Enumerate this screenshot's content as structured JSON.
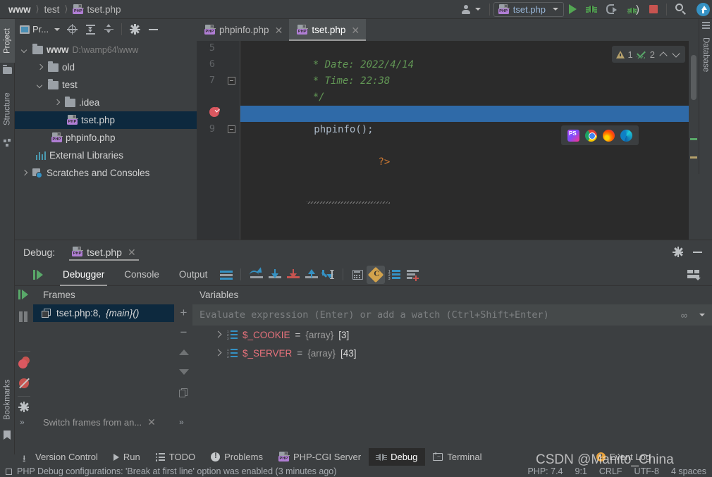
{
  "breadcrumb": {
    "items": [
      "www",
      "test",
      "tset.php"
    ]
  },
  "toolbar": {
    "user_icon": "user-account-icon",
    "run_config": {
      "label": "tset.php",
      "icon": "php-file-icon"
    },
    "run_label": "Run",
    "debug_label": "Debug",
    "attach_label": "Attach to Process",
    "listen_label": "Listen for PHP Debug Connections",
    "stop_label": "Stop",
    "search_label": "Search Everywhere",
    "update_label": "Update"
  },
  "left_strip": {
    "tabs": [
      "Project",
      "Structure",
      "Bookmarks"
    ]
  },
  "right_strip": {
    "tabs": [
      "Database"
    ]
  },
  "project": {
    "title": "Pr...",
    "toolbar_icons": [
      "locate-icon",
      "expand-all-icon",
      "collapse-all-icon",
      "settings-icon",
      "hide-icon"
    ],
    "tree": [
      {
        "label": "www",
        "path": "D:\\wamp64\\www",
        "type": "folder",
        "state": "expanded",
        "indent": 0,
        "bold": true
      },
      {
        "label": "old",
        "type": "folder",
        "state": "collapsed",
        "indent": 1
      },
      {
        "label": "test",
        "type": "folder",
        "state": "expanded",
        "indent": 1
      },
      {
        "label": ".idea",
        "type": "folder",
        "state": "collapsed",
        "indent": 2
      },
      {
        "label": "tset.php",
        "type": "php",
        "state": "none",
        "indent": 3,
        "selected": true
      },
      {
        "label": "phpinfo.php",
        "type": "php",
        "state": "none",
        "indent": 2
      },
      {
        "label": "External Libraries",
        "type": "library",
        "state": "none",
        "indent": 1
      },
      {
        "label": "Scratches and Consoles",
        "type": "scratch",
        "state": "collapsed",
        "indent": 0
      }
    ]
  },
  "editor": {
    "tabs": [
      {
        "label": "phpinfo.php",
        "active": false
      },
      {
        "label": "tset.php",
        "active": true
      }
    ],
    "lines": [
      {
        "num": "5",
        "text": " * Date: 2022/4/14",
        "kind": "comment"
      },
      {
        "num": "6",
        "text": " * Time: 22:38",
        "kind": "comment"
      },
      {
        "num": "7",
        "text": " */",
        "kind": "comment",
        "fold": true
      },
      {
        "num": "8",
        "text": "phpinfo();",
        "kind": "code",
        "highlighted": true,
        "breakpoint": true
      },
      {
        "num": "9",
        "text": "?>",
        "kind": "closetag",
        "fold": true,
        "warning": true
      }
    ],
    "inspection": {
      "warnings": "1",
      "checks": "2"
    },
    "browsers": [
      "phpstorm-icon",
      "chrome-icon",
      "firefox-icon",
      "edge-icon"
    ]
  },
  "debug": {
    "header_label": "Debug:",
    "header_tab": "tset.php",
    "header_icons": [
      "settings-icon",
      "hide-icon"
    ],
    "tabs": [
      {
        "label": "Debugger",
        "active": true
      },
      {
        "label": "Console",
        "active": false
      },
      {
        "label": "Output",
        "active": false
      }
    ],
    "toolbar_icons": [
      "resume-program-icon",
      "show-execution-point-icon",
      "step-over-icon",
      "step-into-icon",
      "force-step-into-icon",
      "step-out-icon",
      "run-to-cursor-icon",
      "evaluate-expression-icon",
      "mute-breakpoints-icon",
      "variables-icon",
      "settings-list-icon",
      "layout-icon"
    ],
    "side_icons": [
      "resume-icon",
      "pause-icon",
      "stop-icon",
      "view-breakpoints-icon",
      "mute-breakpoints-icon",
      "settings-icon",
      "expand-icon"
    ],
    "frames": {
      "title": "Frames",
      "items": [
        {
          "label": "tset.php:8,",
          "suffix": "{main}()",
          "selected": true
        }
      ],
      "footer": "Switch frames from an..."
    },
    "variables": {
      "title": "Variables",
      "evaluate_placeholder": "Evaluate expression (Enter) or add a watch (Ctrl+Shift+Enter)",
      "items": [
        {
          "name": "$_COOKIE",
          "eq": "=",
          "type": "{array}",
          "count": "[3]"
        },
        {
          "name": "$_SERVER",
          "eq": "=",
          "type": "{array}",
          "count": "[43]"
        }
      ],
      "side_icons": [
        "add-watch-icon",
        "remove-watch-icon",
        "move-up-icon",
        "move-down-icon",
        "copy-icon"
      ]
    }
  },
  "bottom_bar": {
    "items": [
      {
        "label": "Version Control",
        "icon": "branch-icon",
        "active": false
      },
      {
        "label": "Run",
        "icon": "run-icon",
        "active": false
      },
      {
        "label": "TODO",
        "icon": "todo-icon",
        "active": false
      },
      {
        "label": "Problems",
        "icon": "problems-icon",
        "active": false
      },
      {
        "label": "PHP-CGI Server",
        "icon": "php-file-icon",
        "active": false
      },
      {
        "label": "Debug",
        "icon": "debug-bug-icon",
        "active": true
      },
      {
        "label": "Terminal",
        "icon": "terminal-icon",
        "active": false
      },
      {
        "label": "Event Log",
        "icon": "event-log-icon",
        "active": false,
        "badge": "2"
      }
    ]
  },
  "status_bar": {
    "message": "PHP Debug configurations: 'Break at first line' option was enabled (3 minutes ago)",
    "right": [
      "PHP: 7.4",
      "9:1",
      "CRLF",
      "UTF-8",
      "4 spaces"
    ]
  },
  "watermark": "CSDN @Manito_China",
  "colors": {
    "background": "#3c3f41",
    "editor_bg": "#2b2b2b",
    "selection_blue": "#2f6aa8",
    "tree_selection": "#0d293e",
    "accent_green": "#59a869",
    "accent_red": "#c75450",
    "comment_green": "#629755",
    "var_red": "#e8727c",
    "php_purple": "#b07ed4"
  }
}
